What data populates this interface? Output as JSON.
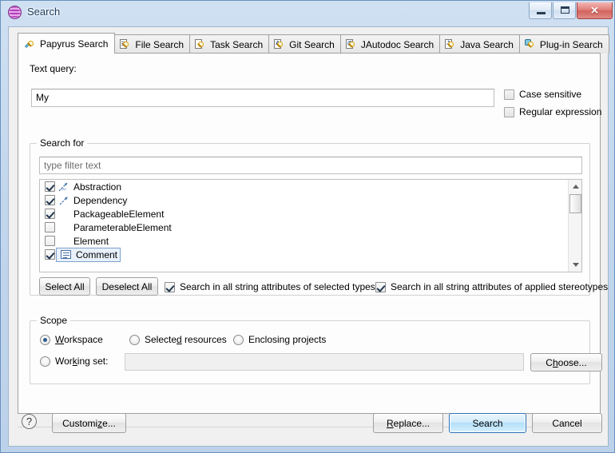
{
  "window": {
    "title": "Search",
    "app_icon": "papyrus-sphere-icon",
    "minimize_label": "",
    "maximize_label": "",
    "close_label": "✕"
  },
  "tabs": [
    {
      "label": "Papyrus Search",
      "icon": "papyrus-search-icon",
      "active": true
    },
    {
      "label": "File Search",
      "icon": "file-search-icon",
      "active": false
    },
    {
      "label": "Task Search",
      "icon": "task-search-icon",
      "active": false
    },
    {
      "label": "Git Search",
      "icon": "git-search-icon",
      "active": false,
      "badge": "A"
    },
    {
      "label": "JAutodoc Search",
      "icon": "jautodoc-search-icon",
      "active": false,
      "badge": "@"
    },
    {
      "label": "Java Search",
      "icon": "java-search-icon",
      "active": false,
      "badge": "J"
    },
    {
      "label": "Plug-in Search",
      "icon": "plugin-search-icon",
      "active": false
    }
  ],
  "query": {
    "label": "Text query:",
    "value": "My",
    "case_sensitive": {
      "label": "Case sensitive",
      "checked": false
    },
    "regular_expression": {
      "label": "Regular expression",
      "checked": false
    }
  },
  "search_for": {
    "title": "Search for",
    "filter_placeholder": "type filter text",
    "filter_value": "",
    "items": [
      {
        "label": "Abstraction",
        "checked": true,
        "icon": "abstraction-arrow-icon",
        "selected": false
      },
      {
        "label": "Dependency",
        "checked": true,
        "icon": "dependency-arrow-icon",
        "selected": false
      },
      {
        "label": "PackageableElement",
        "checked": true,
        "icon": "none",
        "selected": false
      },
      {
        "label": "ParameterableElement",
        "checked": false,
        "icon": "none",
        "selected": false
      },
      {
        "label": "Element",
        "checked": false,
        "icon": "none",
        "selected": false
      },
      {
        "label": "Comment",
        "checked": true,
        "icon": "comment-note-icon",
        "selected": true
      }
    ],
    "select_all_label": "Select All",
    "deselect_all_label": "Deselect All",
    "search_selected_types": {
      "label": "Search in all string attributes of selected types",
      "checked": true
    },
    "search_applied_stereotypes": {
      "label": "Search in all string attributes of applied stereotypes",
      "checked": true
    }
  },
  "scope": {
    "title": "Scope",
    "options": [
      {
        "label": "Workspace",
        "mnemonic": "W",
        "selected": true
      },
      {
        "label": "Selected resources",
        "mnemonic": "d",
        "selected": false
      },
      {
        "label": "Enclosing projects",
        "mnemonic": "",
        "selected": false
      }
    ],
    "working_set": {
      "label": "Working set:",
      "mnemonic": "k",
      "selected": false,
      "value": "",
      "choose_label": "Choose...",
      "choose_mnemonic": "h"
    }
  },
  "footer": {
    "help_label": "?",
    "customize_label": "Customize...",
    "customize_mnemonic": "z",
    "replace_label": "Replace...",
    "replace_mnemonic": "R",
    "search_label": "Search",
    "cancel_label": "Cancel"
  },
  "colors": {
    "accent": "#2c72b8",
    "titlebar_start": "#cfe0f2",
    "selection": "#e8f1fb",
    "close_button": "#d2615c"
  }
}
